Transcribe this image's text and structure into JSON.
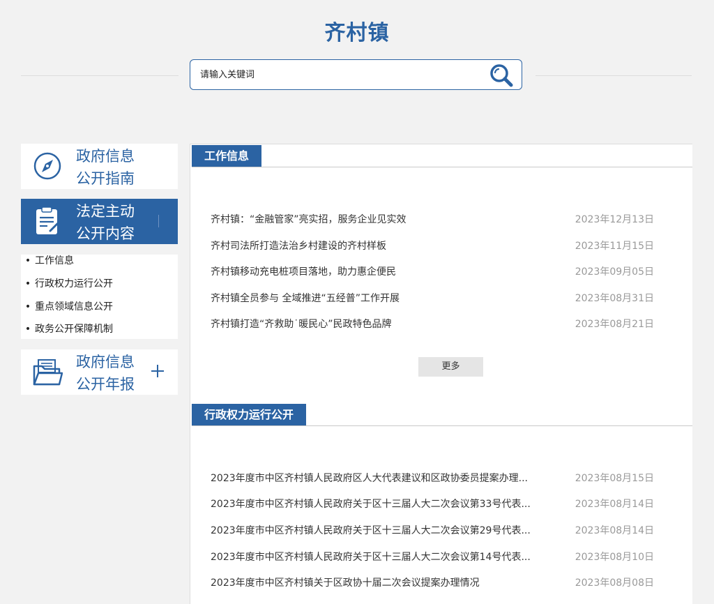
{
  "header": {
    "title": "齐村镇"
  },
  "search": {
    "placeholder": "请输入关键词",
    "icon": "search-icon"
  },
  "sidebar": {
    "cards": [
      {
        "line1": "政府信息",
        "line2": "公开指南",
        "icon": "compass-icon",
        "active": false
      },
      {
        "line1": "法定主动",
        "line2": "公开内容",
        "icon": "clipboard-icon",
        "active": true
      },
      {
        "line1": "政府信息",
        "line2": "公开年报",
        "icon": "folder-icon",
        "active": false,
        "toggle": "plus-icon"
      }
    ],
    "submenu": [
      "工作信息",
      "行政权力运行公开",
      "重点领域信息公开",
      "政务公开保障机制"
    ]
  },
  "sections": [
    {
      "title": "工作信息",
      "items": [
        {
          "title": "齐村镇：“金融管家”亮实招，服务企业见实效",
          "date": "2023年12月13日"
        },
        {
          "title": "齐村司法所打造法治乡村建设的齐村样板",
          "date": "2023年11月15日"
        },
        {
          "title": "齐村镇移动充电桩项目落地，助力惠企便民",
          "date": "2023年09月05日"
        },
        {
          "title": "齐村镇全员参与 全域推进“五经普”工作开展",
          "date": "2023年08月31日"
        },
        {
          "title": "齐村镇打造“齐救助˙暖民心”民政特色品牌",
          "date": "2023年08月21日"
        }
      ],
      "more_label": "更多"
    },
    {
      "title": "行政权力运行公开",
      "items": [
        {
          "title": "2023年度市中区齐村镇人民政府区人大代表建议和区政协委员提案办理...",
          "date": "2023年08月15日"
        },
        {
          "title": "2023年度市中区齐村镇人民政府关于区十三届人大二次会议第33号代表...",
          "date": "2023年08月14日"
        },
        {
          "title": "2023年度市中区齐村镇人民政府关于区十三届人大二次会议第29号代表...",
          "date": "2023年08月14日"
        },
        {
          "title": "2023年度市中区齐村镇人民政府关于区十三届人大二次会议第14号代表...",
          "date": "2023年08月10日"
        },
        {
          "title": "2023年度市中区齐村镇关于区政协十届二次会议提案办理情况",
          "date": "2023年08月08日"
        }
      ]
    }
  ],
  "colors": {
    "accent": "#2b63a3",
    "background": "#f2f2f2",
    "date": "#999999"
  }
}
